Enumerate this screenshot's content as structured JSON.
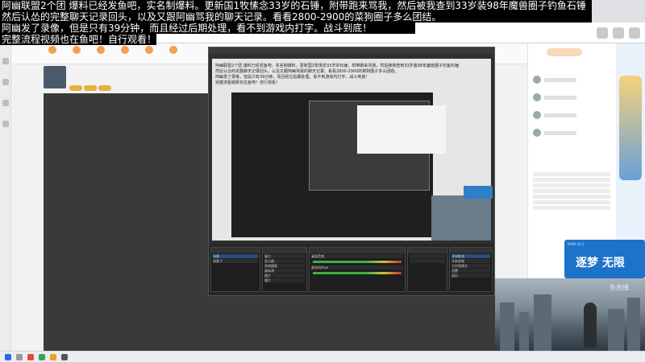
{
  "overlay": {
    "line1": "阿幽联盟2个团 爆料已经发鱼吧，实名制爆料。更新国1牧愫念33岁的石锤，附带跑来骂我，然后被我查到33岁装98年魔兽圈子钓鱼石锤",
    "line2": "然后认怂的完整聊天记录回头，以及又跟阿幽骂我的聊天记录。看看2800-2900的菜狗圈子多么团结。",
    "line3": "阿幽发了录像，但是只有39分钟，而且经过后期处理，看不到游戏内打字。战斗到底！",
    "line4": "完整流程视频也在鱼吧！自行观看！"
  },
  "obs": {
    "scene_rows": [
      "场景",
      "场景 2"
    ],
    "source_rows": [
      "窗口",
      "显示器",
      "游戏捕获",
      "媒体源",
      "图片",
      "图片"
    ],
    "mixer_rows": [
      "桌面音频",
      "麦克风/Aux"
    ],
    "control_rows": [
      "开始推流",
      "开始录制",
      "工作室模式",
      "设置",
      "退出"
    ]
  },
  "ad": {
    "top": "BAKA 学习",
    "text": "逐梦 无限"
  },
  "webcam_logo": "鱼直播",
  "colors": {
    "ad_blue": "#1d72c9",
    "accent_orange": "#f0a050"
  }
}
